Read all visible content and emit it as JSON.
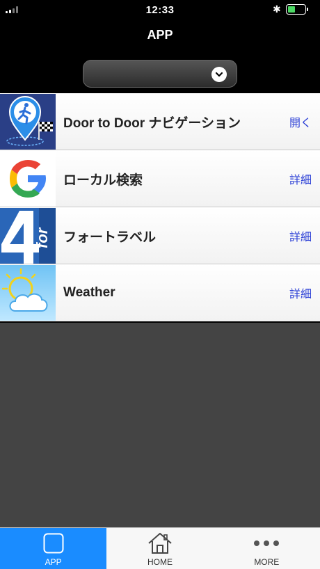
{
  "status_bar": {
    "time": "12:33"
  },
  "header": {
    "title": "APP"
  },
  "apps": [
    {
      "name": "Door to Door ナビゲーション",
      "action": "開く",
      "icon": "walking-navigation-icon"
    },
    {
      "name": "ローカル検索",
      "action": "詳細",
      "icon": "google-g-icon"
    },
    {
      "name": "フォートラベル",
      "action": "詳細",
      "icon": "4travel-icon"
    },
    {
      "name": "Weather",
      "action": "詳細",
      "icon": "weather-sun-cloud-icon"
    }
  ],
  "tabs": [
    {
      "label": "APP",
      "icon": "app-square-icon",
      "active": true
    },
    {
      "label": "HOME",
      "icon": "home-icon",
      "active": false
    },
    {
      "label": "MORE",
      "icon": "more-dots-icon",
      "active": false
    }
  ],
  "colors": {
    "accent": "#1a8cff",
    "link": "#2b3fd6",
    "background": "#444444"
  }
}
